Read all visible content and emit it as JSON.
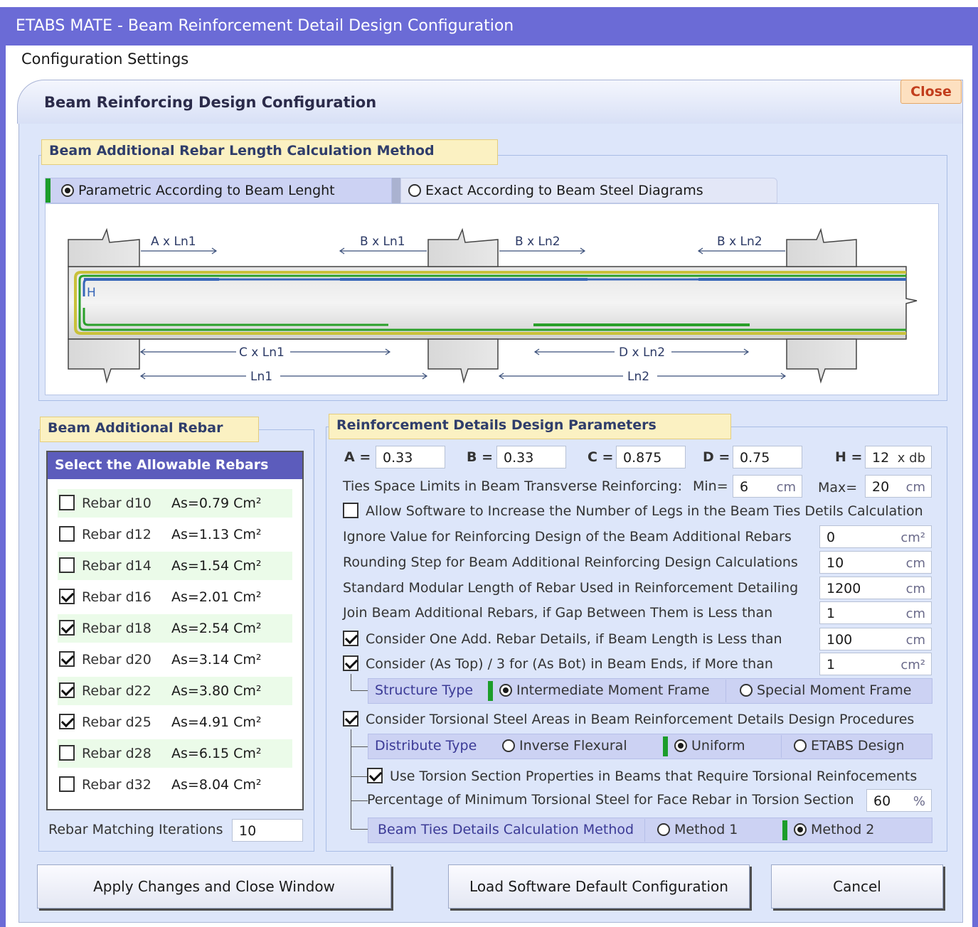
{
  "window": {
    "title": "ETABS MATE - Beam Reinforcement Detail Design Configuration"
  },
  "menu": {
    "label": "Configuration Settings"
  },
  "main": {
    "tab_title": "Beam Reinforcing Design Configuration",
    "close_label": "Close"
  },
  "length_method": {
    "title": "Beam Additional Rebar Length Calculation Method",
    "option1": "Parametric According to Beam Lenght",
    "option2": "Exact According to Beam Steel Diagrams",
    "selected": "option1"
  },
  "diagram": {
    "labels": [
      "A x Ln1",
      "B x Ln1",
      "B x Ln2",
      "B x Ln2",
      "C x Ln1",
      "D x Ln2",
      "Ln1",
      "Ln2",
      "H"
    ]
  },
  "additional_rebar": {
    "title": "Beam Additional Rebar",
    "list_title": "Select the Allowable Rebars",
    "items": [
      {
        "label": "Rebar d10",
        "area": "As=0.79 Cm²",
        "checked": false
      },
      {
        "label": "Rebar d12",
        "area": "As=1.13 Cm²",
        "checked": false
      },
      {
        "label": "Rebar d14",
        "area": "As=1.54 Cm²",
        "checked": false
      },
      {
        "label": "Rebar d16",
        "area": "As=2.01 Cm²",
        "checked": true
      },
      {
        "label": "Rebar d18",
        "area": "As=2.54 Cm²",
        "checked": true
      },
      {
        "label": "Rebar d20",
        "area": "As=3.14 Cm²",
        "checked": true
      },
      {
        "label": "Rebar d22",
        "area": "As=3.80 Cm²",
        "checked": true
      },
      {
        "label": "Rebar d25",
        "area": "As=4.91 Cm²",
        "checked": true
      },
      {
        "label": "Rebar d28",
        "area": "As=6.15 Cm²",
        "checked": false
      },
      {
        "label": "Rebar d32",
        "area": "As=8.04 Cm²",
        "checked": false
      }
    ],
    "iterations_label": "Rebar Matching Iterations",
    "iterations_value": "10"
  },
  "params": {
    "title": "Reinforcement Details Design Parameters",
    "A": {
      "label": "A =",
      "value": "0.33"
    },
    "B": {
      "label": "B =",
      "value": "0.33"
    },
    "C": {
      "label": "C =",
      "value": "0.875"
    },
    "D": {
      "label": "D =",
      "value": "0.75"
    },
    "H": {
      "label": "H =",
      "value": "12",
      "unit": "x db"
    },
    "ties_label": "Ties Space Limits in Beam Transverse Reinforcing:",
    "min_label": "Min=",
    "min_value": "6",
    "min_unit": "cm",
    "max_label": "Max=",
    "max_value": "20",
    "max_unit": "cm",
    "allow_legs": {
      "label": "Allow Software to Increase the Number of Legs in the Beam Ties Detils Calculation",
      "checked": false
    },
    "ignore": {
      "label": "Ignore Value for Reinforcing Design of the Beam Additional Rebars",
      "value": "0",
      "unit": "cm²"
    },
    "rounding": {
      "label": "Rounding Step for Beam Additional Reinforcing Design Calculations",
      "value": "10",
      "unit": "cm"
    },
    "modular": {
      "label": "Standard Modular Length of Rebar Used in Reinforcement Detailing",
      "value": "1200",
      "unit": "cm"
    },
    "join": {
      "label": "Join Beam Additional Rebars, if Gap Between Them is Less than",
      "value": "1",
      "unit": "cm"
    },
    "one_add": {
      "label": "Consider One Add. Rebar Details, if Beam Length is Less than",
      "value": "100",
      "unit": "cm",
      "checked": true
    },
    "as_top": {
      "label": "Consider (As Top) / 3  for (As Bot)  in Beam Ends, if  More than",
      "value": "1",
      "unit": "cm²",
      "checked": true
    },
    "structure_type": {
      "label": "Structure Type",
      "option1": "Intermediate Moment Frame",
      "option2": "Special Moment Frame",
      "selected": "option1"
    },
    "torsional": {
      "label": "Consider Torsional Steel Areas in Beam Reinforcement Details Design Procedures",
      "checked": true
    },
    "distribute_type": {
      "label": "Distribute Type",
      "option1": "Inverse Flexural",
      "option2": "Uniform",
      "option3": "ETABS Design",
      "selected": "option2"
    },
    "torsion_props": {
      "label": "Use Torsion Section Properties in Beams that Require Torsional Reinfocements",
      "checked": true
    },
    "percentage": {
      "label": "Percentage of Minimum Torsional Steel for Face Rebar in Torsion Section",
      "value": "60",
      "unit": "%"
    },
    "ties_method": {
      "label": "Beam Ties Details Calculation Method",
      "option1": "Method 1",
      "option2": "Method 2",
      "selected": "option2"
    }
  },
  "buttons": {
    "apply": "Apply Changes and Close Window",
    "load_default": "Load Software Default Configuration",
    "cancel": "Cancel"
  }
}
